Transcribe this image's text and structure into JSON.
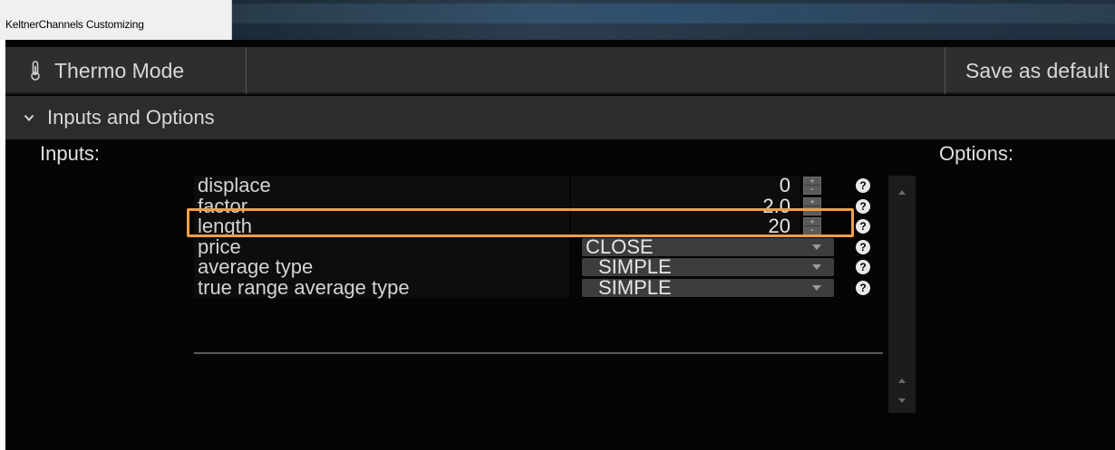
{
  "window": {
    "title": "KeltnerChannels Customizing"
  },
  "toolbar": {
    "thermo_label": "Thermo Mode",
    "thermo_icon": "thermometer-icon",
    "save_label": "Save as default"
  },
  "section": {
    "title": "Inputs and Options",
    "icon": "chevron-down-icon"
  },
  "labels": {
    "inputs": "Inputs:",
    "options": "Options:"
  },
  "inputs": [
    {
      "name": "displace",
      "type": "number",
      "value": "0"
    },
    {
      "name": "factor",
      "type": "number",
      "value": "2.0",
      "highlighted": true
    },
    {
      "name": "length",
      "type": "number",
      "value": "20"
    },
    {
      "name": "price",
      "type": "select",
      "value": "CLOSE"
    },
    {
      "name": "average type",
      "type": "select",
      "value": "SIMPLE"
    },
    {
      "name": "true range average type",
      "type": "select",
      "value": "SIMPLE"
    }
  ],
  "help_glyph": "?",
  "stepper": {
    "plus": "+",
    "minus": "-"
  },
  "colors": {
    "highlight": "#f0a048",
    "panel": "#2e2e2e",
    "background": "#050505"
  }
}
